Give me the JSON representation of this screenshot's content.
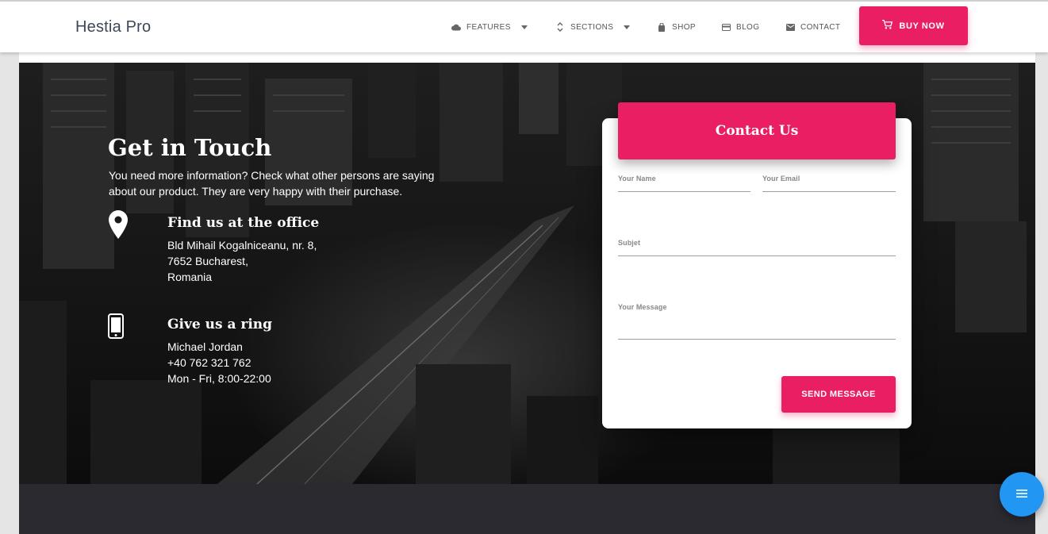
{
  "navbar": {
    "brand": "Hestia Pro",
    "items": [
      {
        "label": "FEATURES",
        "icon": "cloud-icon",
        "has_dropdown": true
      },
      {
        "label": "SECTIONS",
        "icon": "unfold-icon",
        "has_dropdown": true
      },
      {
        "label": "SHOP",
        "icon": "shopping-bag-icon",
        "has_dropdown": false
      },
      {
        "label": "BLOG",
        "icon": "credit-card-icon",
        "has_dropdown": false
      },
      {
        "label": "CONTACT",
        "icon": "mail-icon",
        "has_dropdown": false
      }
    ],
    "cta": {
      "label": "BUY NOW",
      "icon": "cart-icon"
    }
  },
  "contact_section": {
    "title": "Get in Touch",
    "description": "You need more information? Check what other persons are saying about our product. They are very happy with their purchase.",
    "office": {
      "title": "Find us at the office",
      "icon": "location-pin-icon",
      "lines": [
        "Bld Mihail Kogalniceanu, nr. 8,",
        "7652 Bucharest,",
        "Romania"
      ]
    },
    "phone": {
      "title": "Give us a ring",
      "icon": "smartphone-icon",
      "lines": [
        "Michael Jordan",
        "+40 762 321 762",
        "Mon - Fri, 8:00-22:00"
      ]
    }
  },
  "form": {
    "header": "Contact Us",
    "name_label": "Your Name",
    "email_label": "Your Email",
    "subject_label": "Subjet",
    "message_label": "Your Message",
    "submit_label": "SEND MESSAGE"
  },
  "colors": {
    "accent": "#e91e63",
    "fab": "#2196f3",
    "footer": "#2b2a31"
  },
  "fab": {
    "icon": "menu-icon"
  }
}
